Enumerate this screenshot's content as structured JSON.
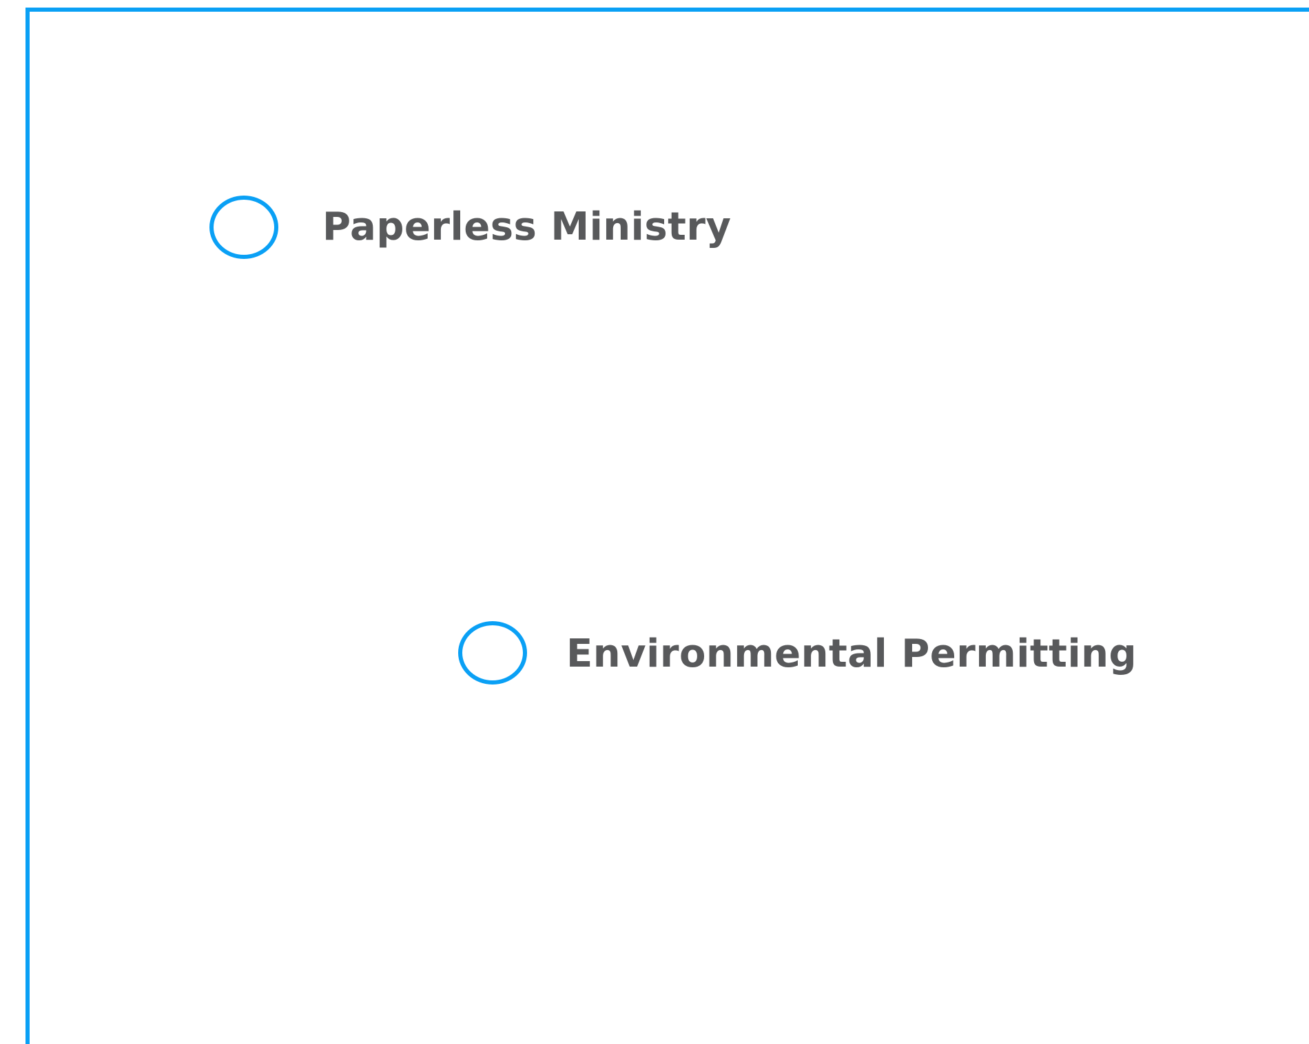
{
  "theme": {
    "accent": "#0aa0f5",
    "text_color": "#58595b",
    "background": "#ffffff"
  },
  "options": [
    {
      "label": "Paperless Ministry",
      "icon": "radio-circle-icon"
    },
    {
      "label": "Environmental Permitting",
      "icon": "radio-circle-icon"
    }
  ]
}
